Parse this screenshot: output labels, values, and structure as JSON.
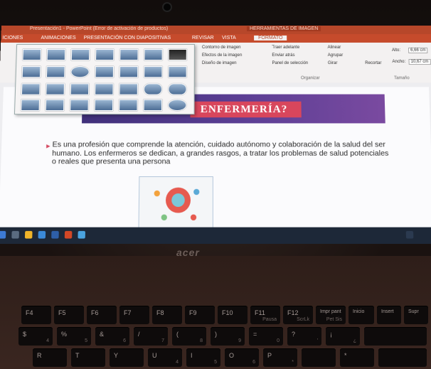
{
  "window": {
    "title": "Presentación1 - PowerPoint (Error de activación de productos)",
    "tool_context": "HERRAMIENTAS DE IMAGEN"
  },
  "ribbon": {
    "tabs": [
      "ICIONES",
      "ANIMACIONES",
      "PRESENTACIÓN CON DIAPOSITIVAS",
      "REVISAR",
      "VISTA",
      "FORMATO"
    ],
    "commands": {
      "picture_border": "Contorno de imagen",
      "picture_effects": "Efectos de la imagen",
      "picture_layout": "Diseño de imagen",
      "bring_forward": "Traer adelante",
      "send_backward": "Enviar atrás",
      "selection_pane": "Panel de selección",
      "align": "Alinear",
      "group": "Agrupar",
      "rotate": "Girar",
      "crop": "Recortar",
      "height": "Alto:",
      "height_value": "6,66 cm",
      "width": "Ancho:",
      "width_value": "10,67 cm"
    },
    "groups": {
      "arrange": "Organizar",
      "size": "Tamaño"
    }
  },
  "slide": {
    "title": "ENFERMERÍA?",
    "bullet": "Es una profesión que comprende la atención, cuidado autónomo y colaboración de la salud del ser humano. Los enfermeros se dedican, a grandes rasgos, a tratar los problemas de salud potenciales o reales que presenta una persona"
  },
  "laptop": {
    "brand": "acer"
  },
  "keyboard": {
    "row1": [
      {
        "label": "F4",
        "sub": ""
      },
      {
        "label": "F5",
        "sub": ""
      },
      {
        "label": "F6",
        "sub": ""
      },
      {
        "label": "F7",
        "sub": ""
      },
      {
        "label": "F8",
        "sub": ""
      },
      {
        "label": "F9",
        "sub": ""
      },
      {
        "label": "F10",
        "sub": ""
      },
      {
        "label": "F11",
        "sub": "Pausa"
      },
      {
        "label": "F12",
        "sub": "ScrLk"
      },
      {
        "label": "Impr pant",
        "sub": "Pet Sis"
      },
      {
        "label": "Inicio",
        "sub": ""
      },
      {
        "label": "Insert",
        "sub": ""
      },
      {
        "label": "Supr",
        "sub": ""
      }
    ],
    "row2": [
      {
        "label": "$",
        "sub": "4"
      },
      {
        "label": "%",
        "sub": "5"
      },
      {
        "label": "&",
        "sub": "6"
      },
      {
        "label": "/",
        "sub": "7"
      },
      {
        "label": "(",
        "sub": "8"
      },
      {
        "label": ")",
        "sub": "9"
      },
      {
        "label": "=",
        "sub": "0"
      },
      {
        "label": "?",
        "sub": "'"
      },
      {
        "label": "¡",
        "sub": "¿"
      },
      {
        "label": "",
        "sub": ""
      }
    ],
    "row3": [
      {
        "label": "R",
        "sub": ""
      },
      {
        "label": "T",
        "sub": ""
      },
      {
        "label": "Y",
        "sub": ""
      },
      {
        "label": "U",
        "sub": "4"
      },
      {
        "label": "I",
        "sub": "5"
      },
      {
        "label": "O",
        "sub": "6"
      },
      {
        "label": "P",
        "sub": "*"
      },
      {
        "label": "",
        "sub": ""
      },
      {
        "label": "*",
        "sub": ""
      }
    ]
  }
}
